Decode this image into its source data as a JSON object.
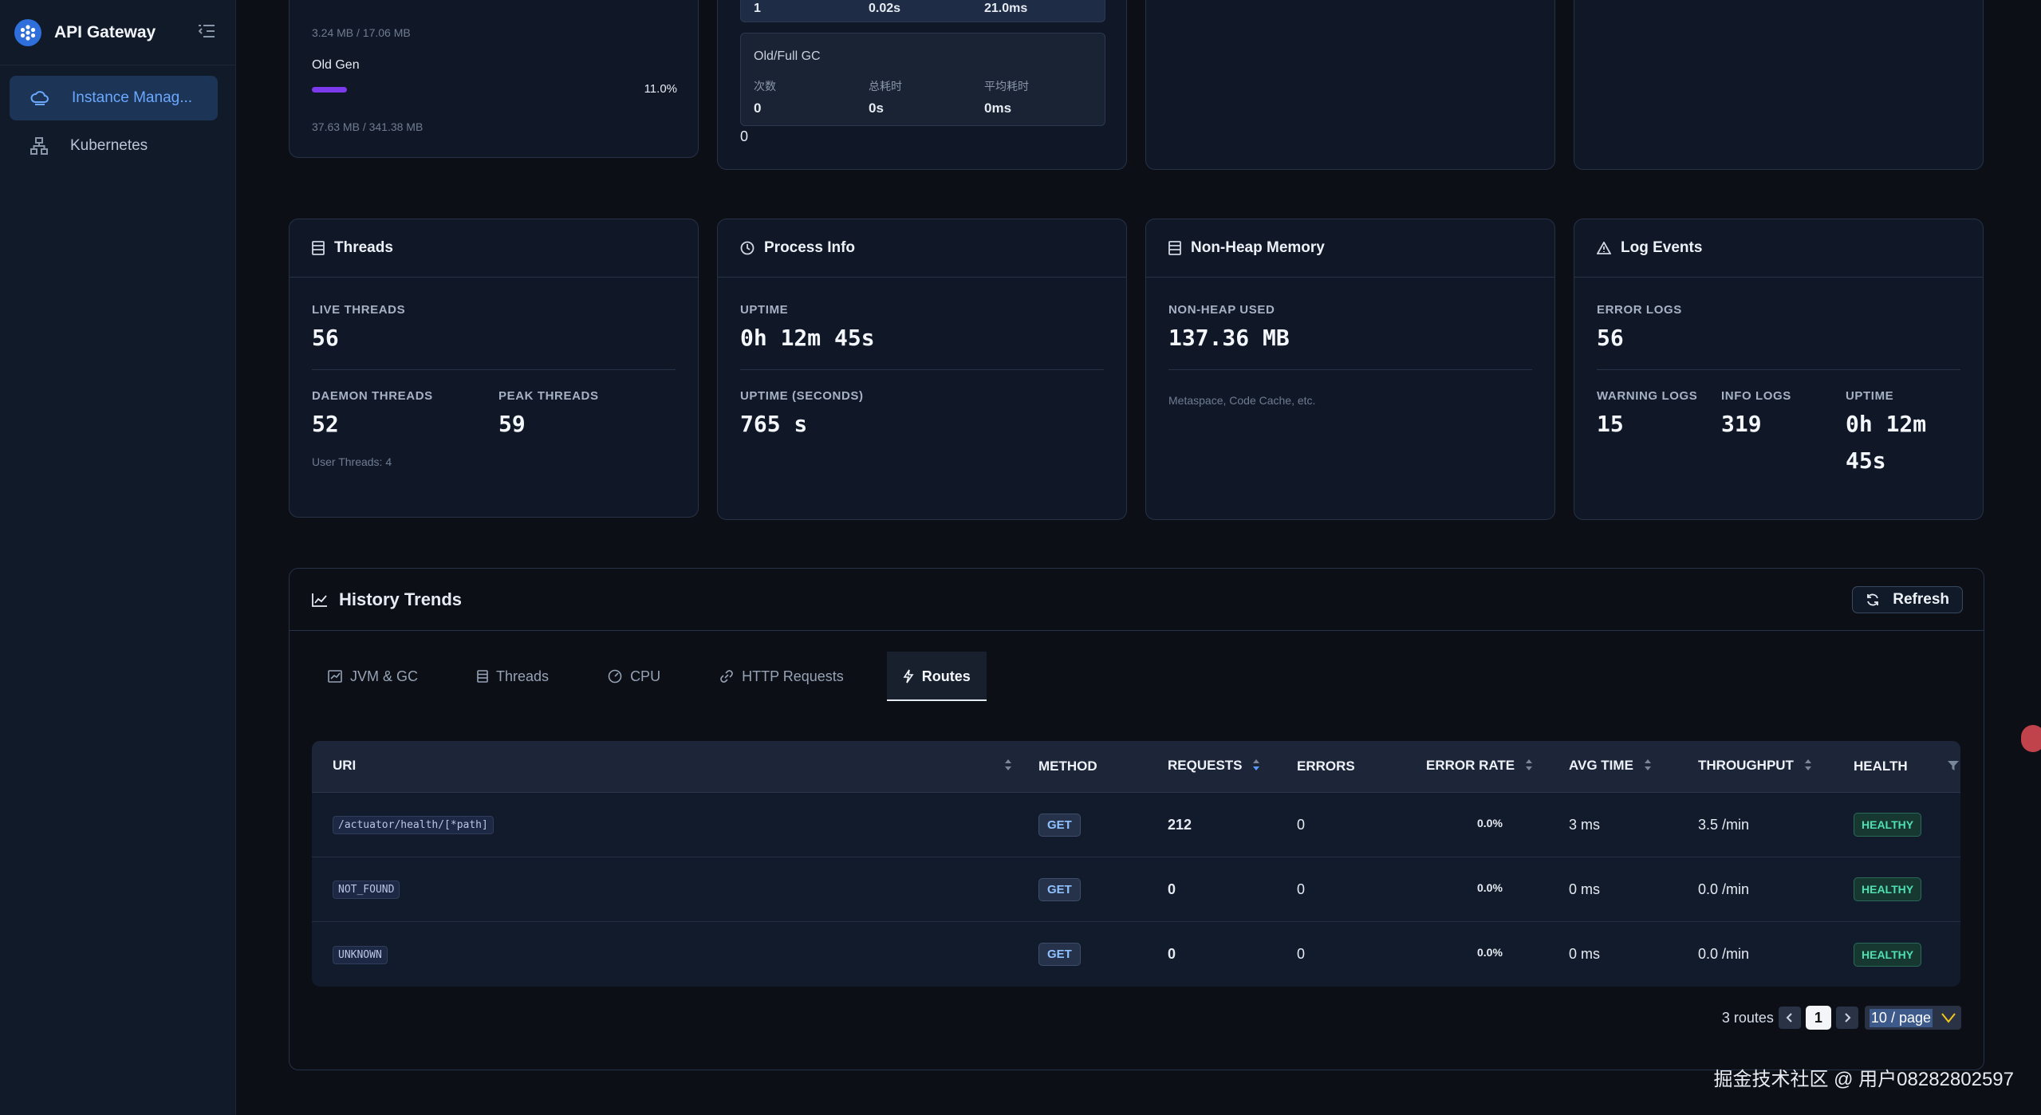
{
  "app": {
    "title": "API Gateway"
  },
  "sidebar": {
    "items": [
      {
        "label": "Instance Manag...",
        "icon": "cloud-icon",
        "active": true
      },
      {
        "label": "Kubernetes",
        "icon": "cluster-icon",
        "active": false
      }
    ]
  },
  "top_partial": {
    "memory": {
      "line1": "3.24 MB / 17.06 MB",
      "old_gen_label": "Old Gen",
      "old_gen_pct": "11.0%",
      "old_gen_fraction": 0.11,
      "old_gen_bar_color": "#7c3aed",
      "old_gen_usage": "37.63 MB / 341.38 MB"
    },
    "gc": {
      "young_row": {
        "count": "1",
        "total": "0.02s",
        "avg": "21.0ms"
      },
      "old_title": "Old/Full GC",
      "headers": {
        "count": "次数",
        "total": "总耗时",
        "avg": "平均耗时"
      },
      "old_row": {
        "count": "0",
        "total": "0s",
        "avg": "0ms"
      },
      "footer": "0"
    }
  },
  "threads": {
    "title": "Threads",
    "live_label": "LIVE THREADS",
    "live": "56",
    "daemon_label": "DAEMON THREADS",
    "daemon": "52",
    "peak_label": "PEAK THREADS",
    "peak": "59",
    "note": "User Threads: 4"
  },
  "process": {
    "title": "Process Info",
    "uptime_label": "UPTIME",
    "uptime": "0h 12m 45s",
    "uptime_sec_label": "UPTIME (SECONDS)",
    "uptime_sec": "765 s"
  },
  "nonheap": {
    "title": "Non-Heap Memory",
    "used_label": "NON-HEAP USED",
    "used": "137.36 MB",
    "note": "Metaspace, Code Cache, etc."
  },
  "logs": {
    "title": "Log Events",
    "error_label": "ERROR LOGS",
    "error": "56",
    "warn_label": "WARNING LOGS",
    "warn": "15",
    "info_label": "INFO LOGS",
    "info": "319",
    "uptime_label": "UPTIME",
    "uptime_l1": "0h 12m",
    "uptime_l2": "45s"
  },
  "history": {
    "title": "History Trends",
    "refresh": "Refresh",
    "tabs": [
      {
        "label": "JVM & GC",
        "icon": "chart-icon"
      },
      {
        "label": "Threads",
        "icon": "list-icon"
      },
      {
        "label": "CPU",
        "icon": "gauge-icon"
      },
      {
        "label": "HTTP Requests",
        "icon": "link-icon"
      },
      {
        "label": "Routes",
        "icon": "bolt-icon",
        "active": true
      }
    ],
    "columns": {
      "uri": "URI",
      "method": "METHOD",
      "requests": "REQUESTS",
      "errors": "ERRORS",
      "error_rate": "ERROR RATE",
      "avg_time": "AVG TIME",
      "throughput": "THROUGHPUT",
      "health": "HEALTH"
    },
    "rows": [
      {
        "uri": "/actuator/health/[*path]",
        "method": "GET",
        "requests": "212",
        "errors": "0",
        "error_rate": "0.0%",
        "avg_time": "3 ms",
        "throughput": "3.5 /min",
        "health": "HEALTHY"
      },
      {
        "uri": "NOT_FOUND",
        "method": "GET",
        "requests": "0",
        "errors": "0",
        "error_rate": "0.0%",
        "avg_time": "0 ms",
        "throughput": "0.0 /min",
        "health": "HEALTHY"
      },
      {
        "uri": "UNKNOWN",
        "method": "GET",
        "requests": "0",
        "errors": "0",
        "error_rate": "0.0%",
        "avg_time": "0 ms",
        "throughput": "0.0 /min",
        "health": "HEALTHY"
      }
    ],
    "pager": {
      "total": "3 routes",
      "page": "1",
      "size": "10 / page"
    }
  },
  "watermark": "掘金技术社区 @ 用户08282802597",
  "colors": {
    "accent": "#6ba8ff",
    "healthy": "#4fe0b0",
    "bg": "#0c0f15",
    "card": "#101828"
  }
}
